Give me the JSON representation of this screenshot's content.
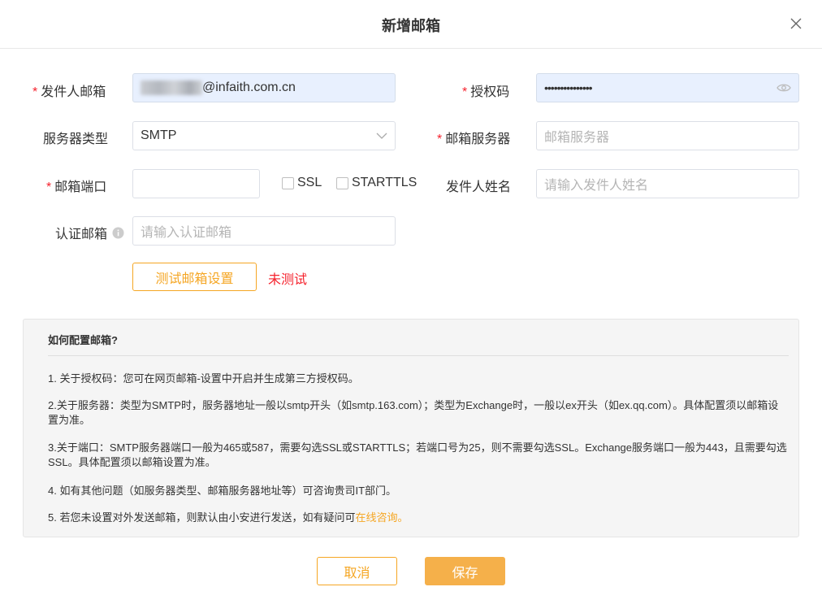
{
  "dialog": {
    "title": "新增邮箱"
  },
  "form": {
    "sender_email": {
      "label": "发件人邮箱",
      "value": "@infaith.com.cn"
    },
    "auth_code": {
      "label": "授权码",
      "value": "•••••••••••••••"
    },
    "server_type": {
      "label": "服务器类型",
      "value": "SMTP"
    },
    "mail_server": {
      "label": "邮箱服务器",
      "placeholder": "邮箱服务器"
    },
    "port": {
      "label": "邮箱端口",
      "value": ""
    },
    "ssl": {
      "label": "SSL",
      "checked": false
    },
    "starttls": {
      "label": "STARTTLS",
      "checked": false
    },
    "sender_name": {
      "label": "发件人姓名",
      "placeholder": "请输入发件人姓名"
    },
    "auth_email": {
      "label": "认证邮箱",
      "placeholder": "请输入认证邮箱"
    },
    "test_button": "测试邮箱设置",
    "test_status": "未测试",
    "required_mark": "*"
  },
  "help": {
    "title": "如何配置邮箱?",
    "items": [
      "1. 关于授权码：您可在网页邮箱-设置中开启并生成第三方授权码。",
      "2.关于服务器：类型为SMTP时，服务器地址一般以smtp开头（如smtp.163.com）；类型为Exchange时，一般以ex开头（如ex.qq.com）。具体配置须以邮箱设置为准。",
      "3.关于端口：SMTP服务器端口一般为465或587，需要勾选SSL或STARTTLS；若端口号为25，则不需要勾选SSL。Exchange服务端口一般为443，且需要勾选SSL。具体配置须以邮箱设置为准。",
      "4. 如有其他问题（如服务器类型、邮箱服务器地址等）可咨询贵司IT部门。"
    ],
    "item5_text": "5. 若您未设置对外发送邮箱，则默认由小安进行发送，如有疑问可",
    "item5_link": "在线咨询。"
  },
  "footer": {
    "cancel": "取消",
    "save": "保存"
  },
  "colors": {
    "accent": "#f5a623",
    "required": "#f5222d",
    "autofill": "#e8f0fe"
  }
}
